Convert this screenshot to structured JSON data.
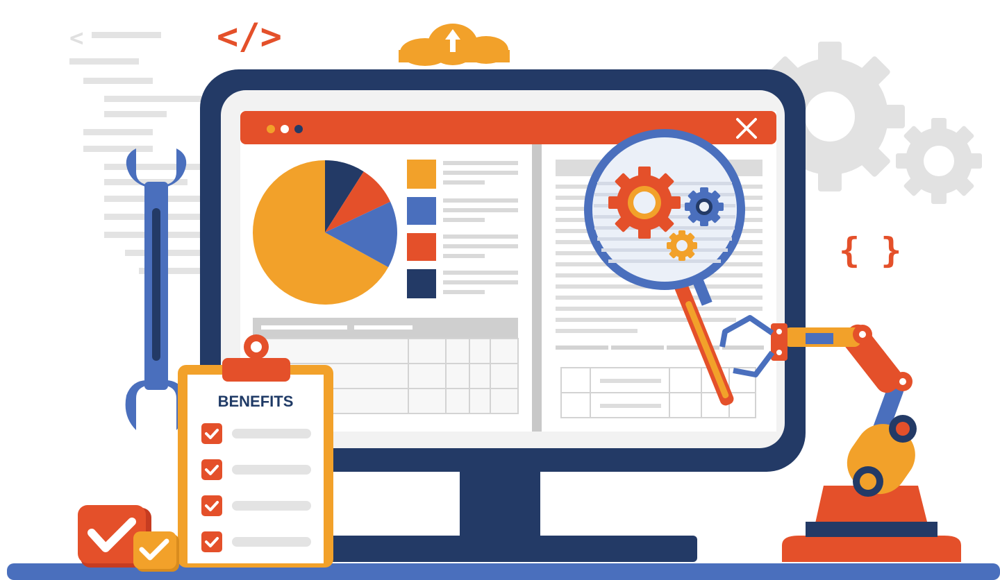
{
  "illustration": {
    "code_tag": "</>",
    "back_arrow": "<",
    "braces": "{ }",
    "checklist_title": "BENEFITS",
    "checklist_items": 4
  },
  "colors": {
    "navy": "#233a66",
    "orange": "#e4502a",
    "amber": "#f2a12a",
    "blue": "#4a6fbd",
    "light_gray": "#e6e6e6",
    "mid_gray": "#cfcfcf"
  },
  "chart_data": {
    "type": "pie",
    "values": [
      67,
      9,
      9,
      15
    ],
    "colors": [
      "#f2a12a",
      "#233a66",
      "#e4502a",
      "#4a6fbd"
    ]
  },
  "icons": [
    "code-tag-icon",
    "cloud-upload-icon",
    "gear-icon",
    "wrench-icon",
    "magnifier-icon",
    "close-icon",
    "checkmark-icon",
    "robot-arm-icon"
  ]
}
